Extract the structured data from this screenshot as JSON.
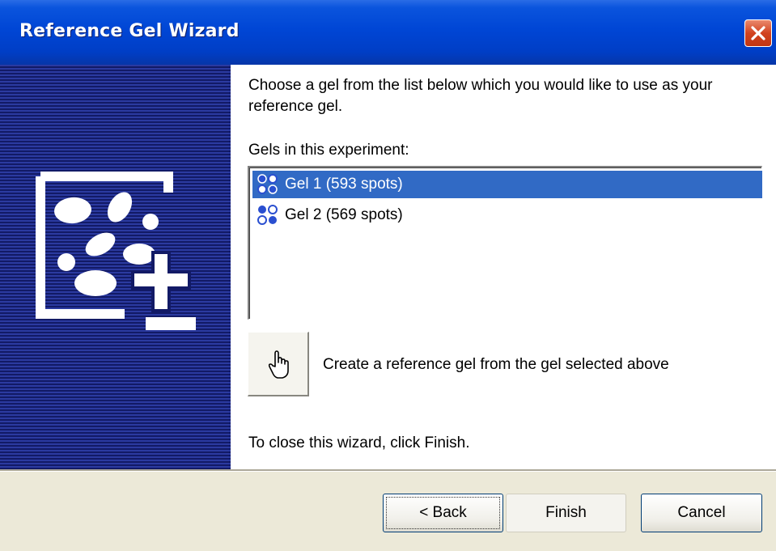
{
  "window": {
    "title": "Reference Gel Wizard",
    "close_icon": "close-icon"
  },
  "intro_text": "Choose a gel from the list below which you would like to use as your reference gel.",
  "list_label": "Gels in this experiment:",
  "gels": [
    {
      "label": "Gel 1 (593 spots)",
      "selected": true,
      "icon": "gel-icon"
    },
    {
      "label": "Gel 2 (569 spots)",
      "selected": false,
      "icon": "gel-icon"
    }
  ],
  "create_action": {
    "label": "Create a reference gel from the gel selected above",
    "icon": "hand-pointer-icon"
  },
  "close_note": "To close this wizard, click Finish.",
  "buttons": {
    "back": "< Back",
    "finish": "Finish",
    "cancel": "Cancel"
  },
  "colors": {
    "title_bar": "#0a54dd",
    "selection": "#316ac5",
    "side_panel": "#1d2a86",
    "face": "#ece9d8"
  }
}
